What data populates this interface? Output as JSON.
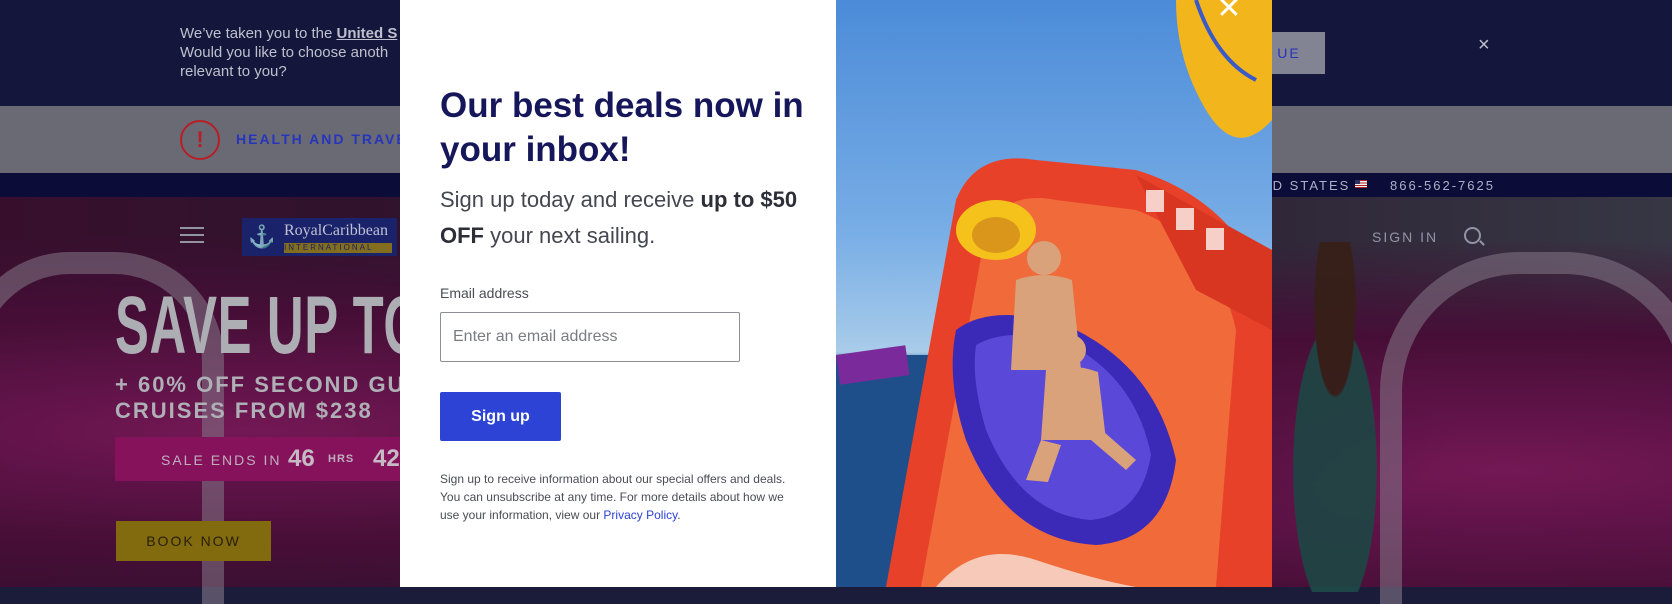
{
  "geo_banner": {
    "text_prefix": "We’ve taken you to the ",
    "link_text": "United S",
    "line2": "Would you like to choose anoth",
    "line3": "relevant to you?",
    "continue_label": "UE",
    "close_glyph": "×"
  },
  "health_bar": {
    "alert_glyph": "!",
    "label": "HEALTH AND TRAVE"
  },
  "utility_bar": {
    "country": "ED STATES",
    "phone": "866-562-7625"
  },
  "header": {
    "logo_mark": "⚓",
    "logo_name": "RoyalCaribbean",
    "logo_sub": "INTERNATIONAL",
    "sign_in": "SIGN IN"
  },
  "hero": {
    "title": "SAVE UP TO",
    "sub_line1": "+ 60% OFF SECOND GU",
    "sub_line2": "CRUISES FROM $238",
    "sale_label": "SALE ENDS IN",
    "hours_value": "46",
    "hours_unit": "HRS",
    "minutes_value": "42",
    "book_now": "BOOK NOW"
  },
  "modal": {
    "title": "Our best deals now in your inbox!",
    "offer_text": "Sign up today and receive",
    "offer_bold": "up to $50 OFF",
    "offer_end": "your next sailing.",
    "email_label": "Email address",
    "email_placeholder": "Enter an email address",
    "email_value": "",
    "signup_label": "Sign up",
    "disclaimer": "Sign up to receive information about our special offers and deals. You can unsubscribe at any time. For more details about how we use your information, view our",
    "privacy_link": "Privacy Policy",
    "disclaimer_end": ".",
    "close_glyph": "✕"
  },
  "colors": {
    "brand_navy": "#15175a",
    "button_blue": "#2d43d6",
    "sale_magenta": "#8e1360",
    "book_gold": "#8a7010"
  }
}
